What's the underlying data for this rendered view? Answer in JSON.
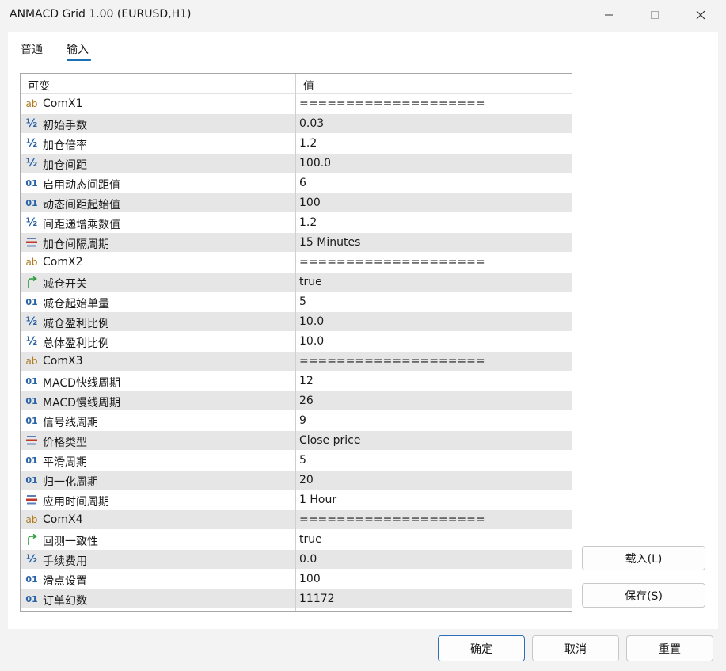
{
  "window": {
    "title": "ANMACD Grid 1.00 (EURUSD,H1)",
    "controls": [
      "minimize-icon",
      "maximize-icon",
      "close-icon"
    ]
  },
  "tabs": [
    {
      "label": "普通",
      "active": false
    },
    {
      "label": "输入",
      "active": true
    }
  ],
  "grid": {
    "headers": {
      "name": "可变",
      "value": "值"
    },
    "rows": [
      {
        "icon": "ab",
        "name": "ComX1",
        "value": "===================="
      },
      {
        "icon": "half",
        "name": "初始手数",
        "value": "0.03"
      },
      {
        "icon": "half",
        "name": "加仓倍率",
        "value": "1.2"
      },
      {
        "icon": "half",
        "name": "加仓间距",
        "value": "100.0"
      },
      {
        "icon": "01",
        "name": "启用动态间距值",
        "value": "6"
      },
      {
        "icon": "01",
        "name": "动态间距起始值",
        "value": "100"
      },
      {
        "icon": "half",
        "name": "间距递增乘数值",
        "value": "1.2"
      },
      {
        "icon": "enum",
        "name": "加仓间隔周期",
        "value": "15 Minutes"
      },
      {
        "icon": "ab",
        "name": "ComX2",
        "value": "===================="
      },
      {
        "icon": "bool",
        "name": "减仓开关",
        "value": "true"
      },
      {
        "icon": "01",
        "name": "减仓起始单量",
        "value": "5"
      },
      {
        "icon": "half",
        "name": "减仓盈利比例",
        "value": "10.0"
      },
      {
        "icon": "half",
        "name": "总体盈利比例",
        "value": "10.0"
      },
      {
        "icon": "ab",
        "name": "ComX3",
        "value": "===================="
      },
      {
        "icon": "01",
        "name": "MACD快线周期",
        "value": "12"
      },
      {
        "icon": "01",
        "name": "MACD慢线周期",
        "value": "26"
      },
      {
        "icon": "01",
        "name": "信号线周期",
        "value": "9"
      },
      {
        "icon": "enum",
        "name": "价格类型",
        "value": "Close price"
      },
      {
        "icon": "01",
        "name": "平滑周期",
        "value": "5"
      },
      {
        "icon": "01",
        "name": "归一化周期",
        "value": "20"
      },
      {
        "icon": "enum",
        "name": "应用时间周期",
        "value": "1 Hour"
      },
      {
        "icon": "ab",
        "name": "ComX4",
        "value": "===================="
      },
      {
        "icon": "bool",
        "name": "回测一致性",
        "value": "true"
      },
      {
        "icon": "half",
        "name": "手续费用",
        "value": "0.0"
      },
      {
        "icon": "01",
        "name": "滑点设置",
        "value": "100"
      },
      {
        "icon": "01",
        "name": "订单幻数",
        "value": "11172"
      }
    ]
  },
  "buttons": {
    "load": "载入(L)",
    "save": "保存(S)",
    "ok": "确定",
    "cancel": "取消",
    "reset": "重置"
  },
  "icon_text": {
    "ab": "ab",
    "half": "½",
    "01": "01"
  },
  "colors": {
    "accent": "#1a6fb5",
    "row_alt": "#e6e6e6",
    "ab_icon": "#b07a20",
    "num_icon": "#2a63a8",
    "bool_icon": "#2a9a3a",
    "enum_icon": "#c0392b"
  }
}
